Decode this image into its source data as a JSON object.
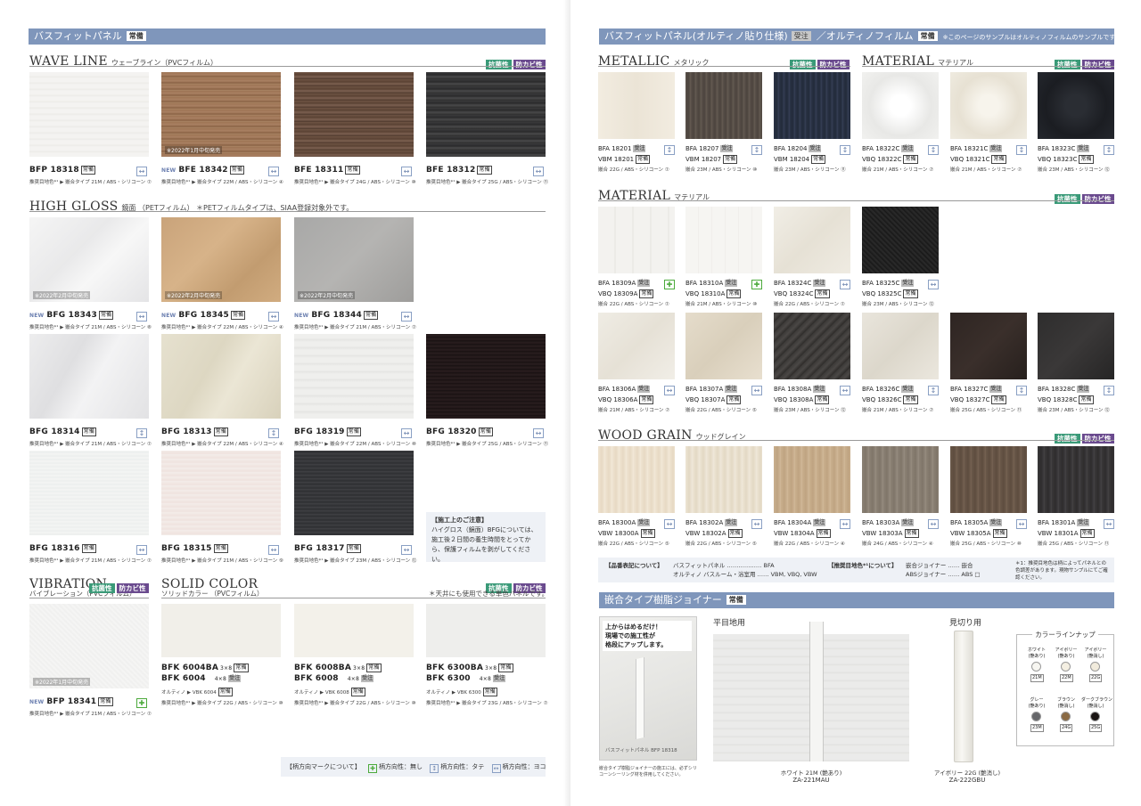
{
  "colors": {
    "band": "#7f96bb",
    "antibac": "#3a9a78",
    "antimold": "#6a4a8e",
    "legend_bg": "#eef1f6"
  },
  "badges": {
    "antibac": "抗菌性",
    "antimold": "防カビ性"
  },
  "left": {
    "band_title": "バスフィットパネル",
    "band_tag": "常備",
    "wave": {
      "en": "WAVE LINE",
      "jp": "ウェーブライン（PVCフィルム）",
      "items": [
        {
          "code": "BFP 18318",
          "st": "常備",
          "spec": "推奨目地色*¹ ▶ 嵌合タイプ 21M / ABS・シリコーン ⑦"
        },
        {
          "new": "NEW",
          "code": "BFE 18342",
          "st": "常備",
          "spec": "推奨目地色*¹ ▶ 嵌合タイプ 22M / ABS・シリコーン ④",
          "ov": "※2022年1月中旬発売"
        },
        {
          "code": "BFE 18311",
          "st": "常備",
          "spec": "推奨目地色*¹ ▶ 嵌合タイプ 24G / ABS・シリコーン ⑩"
        },
        {
          "code": "BFE 18312",
          "st": "常備",
          "spec": "推奨目地色*¹ ▶ 嵌合タイプ 25G / ABS・シリコーン ⑪"
        }
      ]
    },
    "hg": {
      "en": "HIGH GLOSS",
      "jp": "鏡面 （PETフィルム） ＊PETフィルムタイプは、SIAA登録対象外です。",
      "items": [
        {
          "new": "NEW",
          "code": "BFG 18343",
          "st": "常備",
          "spec": "推奨目地色*¹ ▶ 嵌合タイプ 21M / ABS・シリコーン ⑧",
          "ov": "※2022年2月中旬発売"
        },
        {
          "new": "NEW",
          "code": "BFG 18345",
          "st": "常備",
          "spec": "推奨目地色*¹ ▶ 嵌合タイプ 22M / ABS・シリコーン ④",
          "ov": "※2022年2月中旬発売"
        },
        {
          "new": "NEW",
          "code": "BFG 18344",
          "st": "常備",
          "spec": "推奨目地色*¹ ▶ 嵌合タイプ 21M / ABS・シリコーン ⑦",
          "ov": "※2022年2月中旬発売"
        },
        {
          "code": "BFG 18314",
          "st": "常備",
          "spec": "推奨目地色*¹ ▶ 嵌合タイプ 21M / ABS・シリコーン ⑦"
        },
        {
          "code": "BFG 18313",
          "st": "常備",
          "spec": "推奨目地色*¹ ▶ 嵌合タイプ 22M / ABS・シリコーン ④"
        },
        {
          "code": "BFG 18319",
          "st": "常備",
          "spec": "推奨目地色*¹ ▶ 嵌合タイプ 22M / ABS・シリコーン ⑩"
        },
        {
          "code": "BFG 18320",
          "st": "常備",
          "spec": "推奨目地色*¹ ▶ 嵌合タイプ 25G / ABS・シリコーン ⑪"
        },
        {
          "code": "BFG 18316",
          "st": "常備",
          "spec": "推奨目地色*¹ ▶ 嵌合タイプ 21M / ABS・シリコーン ⑦"
        },
        {
          "code": "BFG 18315",
          "st": "常備",
          "spec": "推奨目地色*¹ ▶ 嵌合タイプ 21M / ABS・シリコーン ⑨"
        },
        {
          "code": "BFG 18317",
          "st": "常備",
          "spec": "推奨目地色*¹ ▶ 嵌合タイプ 23M / ABS・シリコーン ⑫"
        }
      ]
    },
    "note": {
      "title": "【施工上のご注意】",
      "body": "ハイグロス（鏡面）BFGについては、施工後２日間の養生時間をとってから、保護フィルムを剥がしてください。"
    },
    "vib": {
      "en": "VIBRATION",
      "jp": "バイブレーション（PVCフィルム）",
      "item": {
        "new": "NEW",
        "code": "BFP 18341",
        "st": "常備",
        "spec": "推奨目地色*¹ ▶ 嵌合タイプ 21M / ABS・シリコーン ⑦",
        "ov": "※2022年1月中旬発売"
      }
    },
    "solid": {
      "en": "SOLID COLOR",
      "jp": "ソリッドカラー （PVCフィルム）",
      "note": "＊天井にも使用できる単色パネルです。",
      "items": [
        {
          "c1": "BFK 6004BA",
          "s1": "3×8",
          "c2": "BFK 6004",
          "s2": "4×8",
          "ol": "オルティノ ▶ VBK 6004",
          "spec": "推奨目地色*¹ ▶ 嵌合タイプ 22G / ABS・シリコーン ⑩"
        },
        {
          "c1": "BFK 6008BA",
          "s1": "3×8",
          "c2": "BFK 6008",
          "s2": "4×8",
          "ol": "オルティノ ▶ VBK 6008",
          "spec": "推奨目地色*¹ ▶ 嵌合タイプ 22G / ABS・シリコーン ⑩"
        },
        {
          "c1": "BFK 6300BA",
          "s1": "3×8",
          "c2": "BFK 6300",
          "s2": "4×8",
          "ol": "オルティノ ▶ VBK 6300",
          "spec": "推奨目地色*¹ ▶ 嵌合タイプ 23G / ABS・シリコーン ⑦"
        }
      ]
    },
    "legend": {
      "title": "【柄方向マークについて】",
      "none": "柄方向性：無し",
      "vert": "柄方向性：タテ",
      "horz": "柄方向性：ヨコ"
    }
  },
  "right": {
    "band_title": "バスフィットパネル(オルティノ貼り仕様)",
    "band_tag1": "受注",
    "band_mid": "／オルティノフィルム",
    "band_tag2": "常備",
    "band_note": "※このページのサンプルはオルティノフィルムのサンプルです。",
    "metallic": {
      "en": "METALLIC",
      "jp": "メタリック",
      "items": [
        {
          "c1": "BFA 18201",
          "s1": "受注",
          "c2": "VBM 18201",
          "s2": "常備",
          "spec": "嵌合 22G / ABS・シリコーン ⑦"
        },
        {
          "c1": "BFA 18207",
          "s1": "受注",
          "c2": "VBM 18207",
          "s2": "常備",
          "spec": "嵌合 23M / ABS・シリコーン ⑩"
        },
        {
          "c1": "BFA 18204",
          "s1": "受注",
          "c2": "VBM 18204",
          "s2": "常備",
          "spec": "嵌合 23M / ABS・シリコーン ⑪"
        }
      ]
    },
    "mat1": {
      "en": "MATERIAL",
      "jp": "マテリアル",
      "items": [
        {
          "c1": "BFA 18322C",
          "s1": "受注",
          "c2": "VBQ 18322C",
          "s2": "常備",
          "spec": "嵌合 21M / ABS・シリコーン ⑦"
        },
        {
          "c1": "BFA 18321C",
          "s1": "受注",
          "c2": "VBQ 18321C",
          "s2": "常備",
          "spec": "嵌合 21M / ABS・シリコーン ⑦"
        },
        {
          "c1": "BFA 18323C",
          "s1": "受注",
          "c2": "VBQ 18323C",
          "s2": "常備",
          "spec": "嵌合 23M / ABS・シリコーン ⑫"
        }
      ]
    },
    "mat2": {
      "en": "MATERIAL",
      "jp": "マテリアル",
      "items": [
        {
          "c1": "BFA 18309A",
          "s1": "受注",
          "c2": "VBQ 18309A",
          "s2": "常備",
          "spec": "嵌合 22G / ABS・シリコーン ⑦"
        },
        {
          "c1": "BFA 18310A",
          "s1": "受注",
          "c2": "VBQ 18310A",
          "s2": "常備",
          "spec": "嵌合 21M / ABS・シリコーン ⑩"
        },
        {
          "c1": "BFA 18324C",
          "s1": "受注",
          "c2": "VBQ 18324C",
          "s2": "常備",
          "spec": "嵌合 22G / ABS・シリコーン ⑦"
        },
        {
          "c1": "BFA 18325C",
          "s1": "受注",
          "c2": "VBQ 18325C",
          "s2": "常備",
          "spec": "嵌合 23M / ABS・シリコーン ⑫"
        },
        {
          "c1": "BFA 18306A",
          "s1": "受注",
          "c2": "VBQ 18306A",
          "s2": "常備",
          "spec": "嵌合 21M / ABS・シリコーン ⑦"
        },
        {
          "c1": "BFA 18307A",
          "s1": "受注",
          "c2": "VBQ 18307A",
          "s2": "常備",
          "spec": "嵌合 22G / ABS・シリコーン ⑤"
        },
        {
          "c1": "BFA 18308A",
          "s1": "受注",
          "c2": "VBQ 18308A",
          "s2": "常備",
          "spec": "嵌合 23M / ABS・シリコーン ⑫"
        },
        {
          "c1": "BFA 18326C",
          "s1": "受注",
          "c2": "VBQ 18326C",
          "s2": "常備",
          "spec": "嵌合 21M / ABS・シリコーン ⑦"
        },
        {
          "c1": "BFA 18327C",
          "s1": "受注",
          "c2": "VBQ 18327C",
          "s2": "常備",
          "spec": "嵌合 25G / ABS・シリコーン ⑪"
        },
        {
          "c1": "BFA 18328C",
          "s1": "受注",
          "c2": "VBQ 18328C",
          "s2": "常備",
          "spec": "嵌合 23M / ABS・シリコーン ⑫"
        }
      ]
    },
    "wood": {
      "en": "WOOD GRAIN",
      "jp": "ウッドグレイン",
      "items": [
        {
          "c1": "BFA 18300A",
          "s1": "受注",
          "c2": "VBW 18300A",
          "s2": "常備",
          "spec": "嵌合 22G / ABS・シリコーン ⑤"
        },
        {
          "c1": "BFA 18302A",
          "s1": "受注",
          "c2": "VBW 18302A",
          "s2": "常備",
          "spec": "嵌合 22G / ABS・シリコーン ⑤"
        },
        {
          "c1": "BFA 18304A",
          "s1": "受注",
          "c2": "VBW 18304A",
          "s2": "常備",
          "spec": "嵌合 22G / ABS・シリコーン ④"
        },
        {
          "c1": "BFA 18303A",
          "s1": "受注",
          "c2": "VBW 18303A",
          "s2": "常備",
          "spec": "嵌合 24G / ABS・シリコーン ④"
        },
        {
          "c1": "BFA 18305A",
          "s1": "受注",
          "c2": "VBW 18305A",
          "s2": "常備",
          "spec": "嵌合 25G / ABS・シリコーン ⑩"
        },
        {
          "c1": "BFA 18301A",
          "s1": "受注",
          "c2": "VBW 18301A",
          "s2": "常備",
          "spec": "嵌合 25G / ABS・シリコーン ⑪"
        }
      ]
    },
    "info": {
      "t1": "【品番表記について】",
      "l1a": "バスフィットパネル ……………… BFA",
      "l1b": "オルティノ バスルーム・浴室用 …… VBM, VBQ, VBW",
      "t2": "【推奨目地色*¹について】",
      "l2a": "嵌合ジョイナー …… 嵌合",
      "l2b": "ABSジョイナー …… ABS □",
      "n": "＊1：推奨目地色は柄によってパネルとの色調差があります。現物サンプルにてご確認ください。"
    },
    "joiner": {
      "band": "嵌合タイプ樹脂ジョイナー",
      "tag": "常備",
      "promo1": "上からはめるだけ！",
      "promo2": "現場での施工性が",
      "promo3": "格段にアップします。",
      "promo_cap": "バスフィットパネル BFP 18318",
      "promo_note": "嵌合タイプ樹脂ジョイナーの施工には、必ずシリコーンシーリング材を併用してください。",
      "flat": "平目地用",
      "flat_cap": "ホワイト 21M (艶あり)",
      "flat_code": "ZA-221MAU",
      "kiri": "見切り用",
      "kiri_cap": "アイボリー 22G (艶消し)",
      "kiri_code": "ZA-222GBU",
      "lineup": "カラーラインナップ",
      "colors": [
        {
          "n": "ホワイト",
          "g": "(艶あり)",
          "c": "21M",
          "hex": "#f7f6f1"
        },
        {
          "n": "アイボリー",
          "g": "(艶あり)",
          "c": "22M",
          "hex": "#f4efe2"
        },
        {
          "n": "アイボリー",
          "g": "(艶消し)",
          "c": "22G",
          "hex": "#f1ebdc"
        },
        {
          "n": "グレー",
          "g": "(艶あり)",
          "c": "23M",
          "hex": "#66676a"
        },
        {
          "n": "ブラウン",
          "g": "(艶消し)",
          "c": "24G",
          "hex": "#8a6a44"
        },
        {
          "n": "ダークブラウン",
          "g": "(艶消し)",
          "c": "25G",
          "hex": "#1a1514"
        }
      ]
    }
  }
}
